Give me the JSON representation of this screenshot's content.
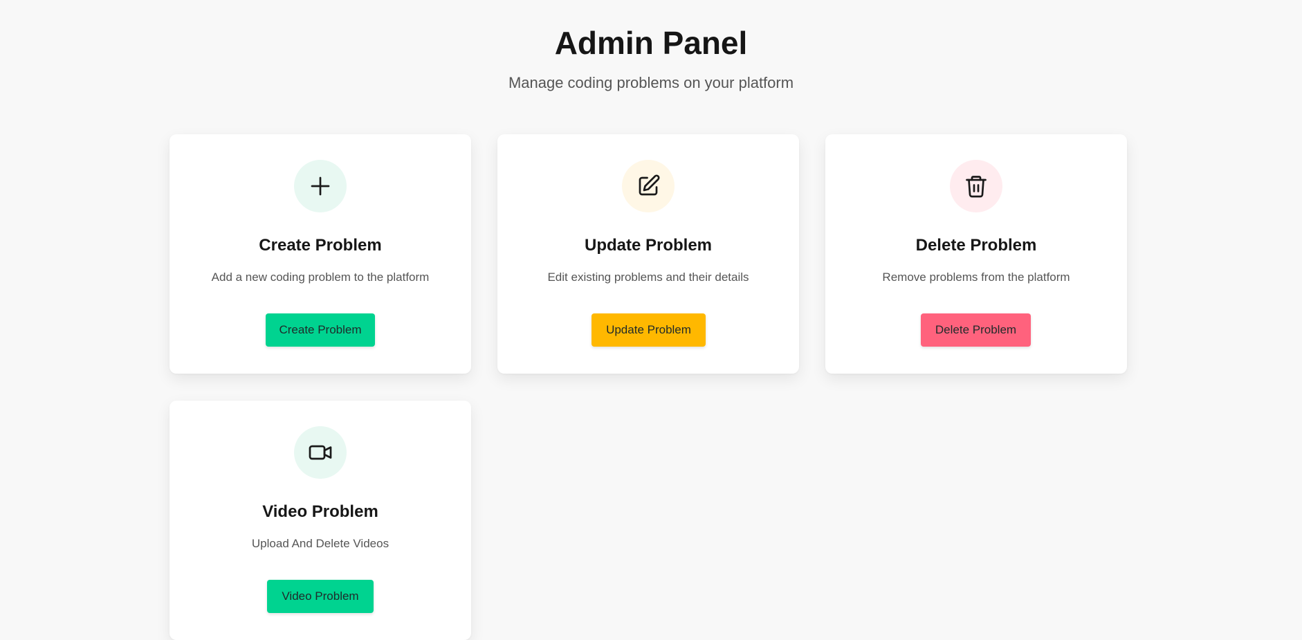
{
  "header": {
    "title": "Admin Panel",
    "subtitle": "Manage coding problems on your platform"
  },
  "cards": [
    {
      "title": "Create Problem",
      "description": "Add a new coding problem to the platform",
      "button_label": "Create Problem",
      "icon": "plus-icon",
      "icon_bg": "#e8f8f2",
      "button_color": "#00d390"
    },
    {
      "title": "Update Problem",
      "description": "Edit existing problems and their details",
      "button_label": "Update Problem",
      "icon": "edit-icon",
      "icon_bg": "#fff7e6",
      "button_color": "#ffb800"
    },
    {
      "title": "Delete Problem",
      "description": "Remove problems from the platform",
      "button_label": "Delete Problem",
      "icon": "trash-icon",
      "icon_bg": "#ffecef",
      "button_color": "#ff627d"
    },
    {
      "title": "Video Problem",
      "description": "Upload And Delete Videos",
      "button_label": "Video Problem",
      "icon": "video-icon",
      "icon_bg": "#e8f8f2",
      "button_color": "#00d390"
    }
  ]
}
